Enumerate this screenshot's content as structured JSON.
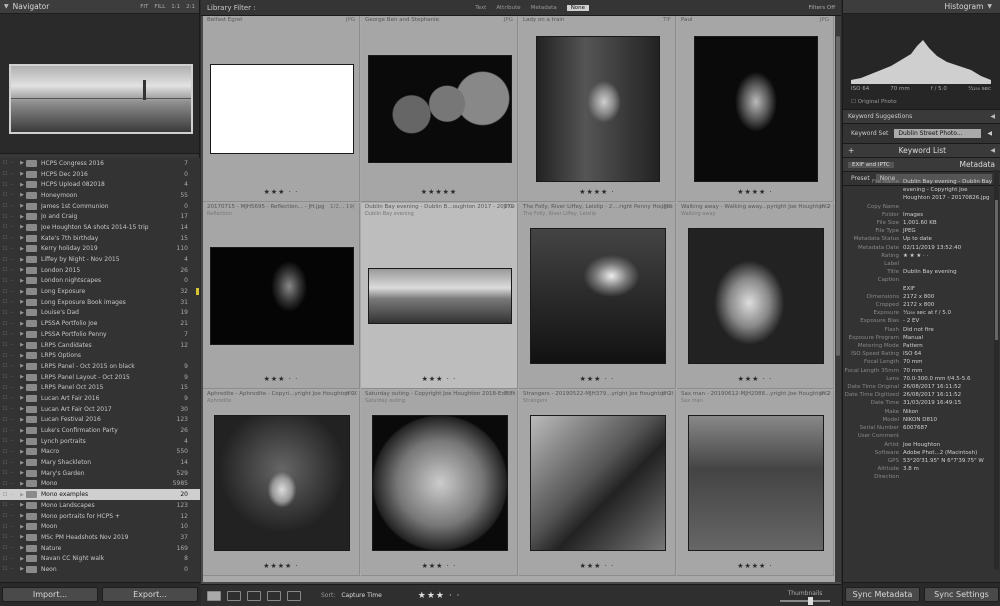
{
  "navigator": {
    "title": "Navigator",
    "zoom_options": [
      "FIT",
      "FILL",
      "1:1",
      "2:1"
    ]
  },
  "collections": [
    {
      "name": "HCPS Congress 2016",
      "count": "7"
    },
    {
      "name": "HCPS Dec 2016",
      "count": "0"
    },
    {
      "name": "HCPS Upload 082018",
      "count": "4"
    },
    {
      "name": "Honeymoon",
      "count": "55"
    },
    {
      "name": "James 1st Communion",
      "count": "0"
    },
    {
      "name": "Jo and Craig",
      "count": "17"
    },
    {
      "name": "Joe Houghton SA shots 2014-15 trip",
      "count": "14"
    },
    {
      "name": "Kate's 7th birthday",
      "count": "15"
    },
    {
      "name": "Kerry holiday 2019",
      "count": "110"
    },
    {
      "name": "Liffey by Night - Nov 2015",
      "count": "4"
    },
    {
      "name": "London 2015",
      "count": "26"
    },
    {
      "name": "London nightscapes",
      "count": "0"
    },
    {
      "name": "Long Exposure",
      "count": "32"
    },
    {
      "name": "Long Exposure Book images",
      "count": "31"
    },
    {
      "name": "Louise's Dad",
      "count": "19"
    },
    {
      "name": "LPSSA Portfolio Joe",
      "count": "21"
    },
    {
      "name": "LPSSA Portfolio Penny",
      "count": "7"
    },
    {
      "name": "LRPS Candidates",
      "count": "12"
    },
    {
      "name": "LRPS Options",
      "count": ""
    },
    {
      "name": "LRPS Panel - Oct 2015 on black",
      "count": "9"
    },
    {
      "name": "LRPS Panel Layout - Oct 2015",
      "count": "9"
    },
    {
      "name": "LRPS Panel Oct 2015",
      "count": "15"
    },
    {
      "name": "Lucan Art Fair 2016",
      "count": "9"
    },
    {
      "name": "Lucan Art Fair Oct 2017",
      "count": "30"
    },
    {
      "name": "Lucan Festival 2016",
      "count": "123"
    },
    {
      "name": "Luke's Confirmation Party",
      "count": "26"
    },
    {
      "name": "Lynch portraits",
      "count": "4"
    },
    {
      "name": "Macro",
      "count": "550"
    },
    {
      "name": "Mary Shackleton",
      "count": "14"
    },
    {
      "name": "Mary's Garden",
      "count": "529"
    },
    {
      "name": "Mono",
      "count": "5985"
    },
    {
      "name": "Mono examples",
      "count": "20"
    },
    {
      "name": "Mono Landscapes",
      "count": "123"
    },
    {
      "name": "Mono portraits for HCPS +",
      "count": "12"
    },
    {
      "name": "Moon",
      "count": "10"
    },
    {
      "name": "MSc PM Headshots Nov 2019",
      "count": "37"
    },
    {
      "name": "Nature",
      "count": "169"
    },
    {
      "name": "Navan CC Night walk",
      "count": "8"
    },
    {
      "name": "Neon",
      "count": "0"
    }
  ],
  "left_buttons": {
    "import": "Import...",
    "export": "Export..."
  },
  "filter": {
    "title": "Library Filter :",
    "options": [
      "Text",
      "Attribute",
      "Metadata",
      "None"
    ],
    "active": "None",
    "status": "Filters Off"
  },
  "grid": [
    {
      "title": "Belfast Egret",
      "ext": "JPG",
      "sub": "",
      "stars": "★★★ · ·",
      "style": "egret"
    },
    {
      "title": "George Ben and Stephanie",
      "ext": "JPG",
      "sub": "",
      "stars": "★★★★★",
      "style": "profiles"
    },
    {
      "title": "Lady on a train",
      "ext": "TIF",
      "sub": "",
      "stars": "★★★★ ·",
      "style": "lady"
    },
    {
      "title": "Paul",
      "ext": "JPG",
      "sub": "",
      "stars": "★★★★ ·",
      "style": "beard"
    },
    {
      "title": "20170715 - MJH5695 - Reflection... - JH.jpg",
      "ext": "1/2... 19(",
      "sub": "Reflection",
      "stars": "★★★ · ·",
      "style": "man"
    },
    {
      "title": "Dublin Bay evening - Dublin B...oughton 2017 - 20170826.jpg",
      "ext": "JPG",
      "sub": "Dublin Bay evening",
      "stars": "★★★ · ·",
      "style": "bay"
    },
    {
      "title": "The Folly, River Liffey, Leixlip - 2....right Penny Houghton 2017.jpg",
      "ext": "JPG",
      "sub": "The Folly, River Liffey, Leixlip",
      "stars": "★★★ · ·",
      "style": "folly"
    },
    {
      "title": "Walking away - Walking away...pyright Joe Houghton 2019.jpg",
      "ext": "JPG",
      "sub": "Walking away",
      "stars": "★★★ · ·",
      "style": "arch"
    },
    {
      "title": "Aphrodite - Aphrodite - Copyri...yright Joe Houghton 2019.jpg",
      "ext": "JPG",
      "sub": "Aphrodite",
      "stars": "★★★★ ·",
      "style": "fur"
    },
    {
      "title": "Saturday outing - Copyright Joe Houghton 2018-Edit.tif",
      "ext": "TIF",
      "sub": "Saturday outing",
      "stars": "★★★ · ·",
      "style": "fisheye"
    },
    {
      "title": "Strangers - 20190522-MJH379...yright Joe Houghton 2019.jpg",
      "ext": "JPG",
      "sub": "Strangers",
      "stars": "★★★ · ·",
      "style": "street"
    },
    {
      "title": "Sax man - 20190612-MJH2088...yright Joe Houghton 2019.jpg",
      "ext": "JPG",
      "sub": "Sax man",
      "stars": "★★★★ ·",
      "style": "sax"
    }
  ],
  "toolbar": {
    "sort_label": "Sort:",
    "sort_value": "Capture Time",
    "stars": "★★★ · ·",
    "thumbnails_label": "Thumbnails"
  },
  "histogram": {
    "title": "Histogram",
    "iso": "ISO 64",
    "focal": "70 mm",
    "aperture": "f / 5.0",
    "shutter": "¹⁄₁₂₅₀ sec",
    "original_photo": "Original Photo"
  },
  "right_panels": {
    "keyword_suggestions": "Keyword Suggestions",
    "keyword_set_label": "Keyword Set",
    "keyword_set_value": "Dublin Street Photo...",
    "keyword_list": "Keyword List",
    "metadata": "Metadata",
    "exif_preset": "EXIF and IPTC",
    "preset_label": "Preset",
    "preset_value": "None"
  },
  "metadata_rows": [
    {
      "k": "File Name",
      "v": "Dublin Bay evening - Dublin Bay evening - Copyright Joe Houghton 2017 - 20170826.jpg"
    },
    {
      "k": "Copy Name",
      "v": ""
    },
    {
      "k": "Folder",
      "v": "Images"
    },
    {
      "k": "File Size",
      "v": "1,001.60 KB"
    },
    {
      "k": "File Type",
      "v": "JPEG"
    },
    {
      "k": "Metadata Status",
      "v": "Up to date"
    },
    {
      "k": "Metadata Date",
      "v": "02/11/2019 13:52:40"
    },
    {
      "k": "Rating",
      "v": "★ ★ ★ · ·"
    },
    {
      "k": "Label",
      "v": ""
    },
    {
      "k": "Title",
      "v": "Dublin Bay evening"
    },
    {
      "k": "Caption",
      "v": ""
    },
    {
      "k": "",
      "v": "EXIF"
    },
    {
      "k": "Dimensions",
      "v": "2172 x 800"
    },
    {
      "k": "Cropped",
      "v": "2172 x 800"
    },
    {
      "k": "Exposure",
      "v": "¹⁄₁₂₅₀ sec at f / 5.0"
    },
    {
      "k": "Exposure Bias",
      "v": "- 2 EV"
    },
    {
      "k": "Flash",
      "v": "Did not fire"
    },
    {
      "k": "Exposure Program",
      "v": "Manual"
    },
    {
      "k": "Metering Mode",
      "v": "Pattern"
    },
    {
      "k": "ISO Speed Rating",
      "v": "ISO 64"
    },
    {
      "k": "Focal Length",
      "v": "70 mm"
    },
    {
      "k": "Focal Length 35mm",
      "v": "70 mm"
    },
    {
      "k": "Lens",
      "v": "70.0-300.0 mm f/4.5-5.6"
    },
    {
      "k": "Date Time Original",
      "v": "26/08/2017 16:11:52"
    },
    {
      "k": "Date Time Digitized",
      "v": "26/08/2017 16:11:52"
    },
    {
      "k": "Date Time",
      "v": "31/03/2019 16:49:15"
    },
    {
      "k": "Make",
      "v": "Nikon"
    },
    {
      "k": "Model",
      "v": "NIKON D810"
    },
    {
      "k": "Serial Number",
      "v": "6007687"
    },
    {
      "k": "User Comment",
      "v": ""
    },
    {
      "k": "Artist",
      "v": "Joe Houghton"
    },
    {
      "k": "Software",
      "v": "Adobe Phot...2 (Macintosh)"
    },
    {
      "k": "GPS",
      "v": "53°20'31.95\" N 6°7'39.75\" W"
    },
    {
      "k": "Altitude",
      "v": "3.8 m"
    },
    {
      "k": "Direction",
      "v": ""
    }
  ],
  "right_buttons": {
    "sync_metadata": "Sync Metadata",
    "sync_settings": "Sync Settings"
  }
}
